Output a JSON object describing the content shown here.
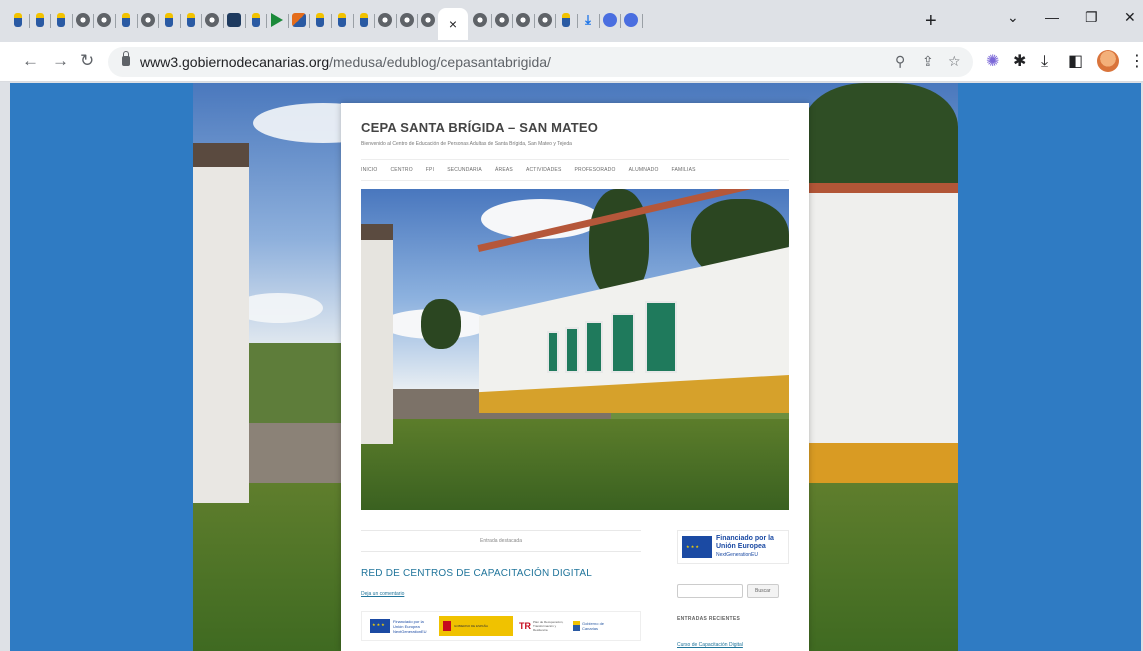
{
  "browser": {
    "tabs": [
      {
        "icon": "canarias-favicon-icon"
      },
      {
        "icon": "canarias-favicon-icon"
      },
      {
        "icon": "canarias-favicon-icon"
      },
      {
        "icon": "globe-favicon-icon"
      },
      {
        "icon": "globe-favicon-icon"
      },
      {
        "icon": "canarias-favicon-icon"
      },
      {
        "icon": "globe-favicon-icon"
      },
      {
        "icon": "canarias-favicon-icon"
      },
      {
        "icon": "canarias-favicon-icon"
      },
      {
        "icon": "globe-favicon-icon"
      },
      {
        "icon": "dark-app-favicon-icon"
      },
      {
        "icon": "canarias-favicon-icon"
      },
      {
        "icon": "play-favicon-icon"
      },
      {
        "icon": "orange-favicon-icon"
      },
      {
        "icon": "canarias-favicon-icon"
      },
      {
        "icon": "canarias-favicon-icon"
      },
      {
        "icon": "canarias-favicon-icon"
      },
      {
        "icon": "globe-favicon-icon"
      },
      {
        "icon": "globe-favicon-icon"
      },
      {
        "icon": "globe-favicon-icon"
      }
    ],
    "active_tab_close": "×",
    "tabs_after": [
      {
        "icon": "globe-favicon-icon"
      },
      {
        "icon": "globe-favicon-icon"
      },
      {
        "icon": "globe-favicon-icon"
      },
      {
        "icon": "globe-favicon-icon"
      },
      {
        "icon": "canarias-favicon-icon"
      },
      {
        "icon": "download-favicon-icon"
      },
      {
        "icon": "blue-circle-favicon-icon"
      },
      {
        "icon": "blue-circle-favicon-icon"
      }
    ],
    "new_tab": "+",
    "url_host": "www3.gobiernodecanarias.org",
    "url_path": "/medusa/edublog/cepasantabrigida/"
  },
  "site": {
    "title": "CEPA SANTA BRÍGIDA – SAN MATEO",
    "tagline": "Bienvenido al Centro de Educación de Personas Adultas de Santa Brígida, San Mateo y Tejeda",
    "nav": [
      "INICIO",
      "CENTRO",
      "FPI",
      "SECUNDARIA",
      "ÁREAS",
      "ACTIVIDADES",
      "PROFESORADO",
      "ALUMNADO",
      "FAMILIAS"
    ]
  },
  "main": {
    "featured_label": "Entrada destacada",
    "post_title": "RED DE CENTROS DE CAPACITACIÓN DIGITAL",
    "comment_link": "Deja un comentario",
    "logos": {
      "eu_text": "Financiado por la Unión Europea NextGenerationEU",
      "es_text": "GOBIERNO DE ESPAÑA",
      "tr_text": "Plan de Recuperación, Transformación y Resiliencia",
      "gc_text": "Gobierno de Canarias"
    }
  },
  "sidebar": {
    "banner_title": "Financiado por la Unión Europea",
    "banner_sub": "NextGenerationEU",
    "search_placeholder": "",
    "search_button": "Buscar",
    "recent_heading": "ENTRADAS RECIENTES",
    "recent_link": "Curso de Capacitación Digital"
  }
}
